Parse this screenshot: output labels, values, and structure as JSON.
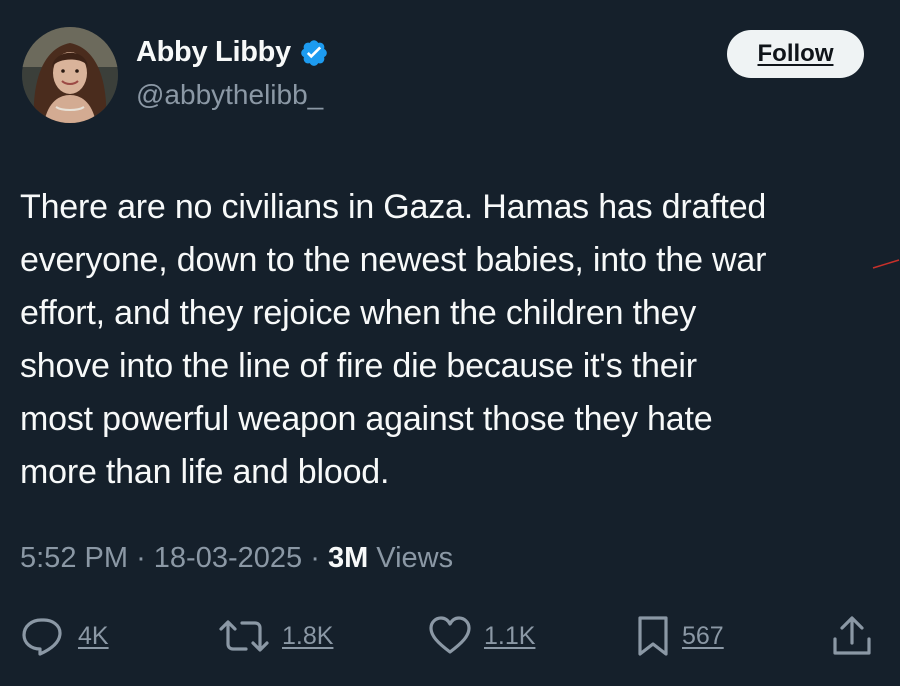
{
  "author": {
    "display_name": "Abby Libby",
    "handle": "@abbythelibb_",
    "verified": true,
    "verified_color": "#1d9bf0"
  },
  "follow_button": {
    "label": "Follow"
  },
  "tweet": {
    "text": "There are no civilians in Gaza. Hamas has drafted\neveryone, down to the newest babies, into the war\neffort, and they rejoice when the children they\nshove into the line of fire die because it's their\nmost powerful weapon against those they hate\nmore than life and blood.",
    "time": "5:52 PM",
    "separator": "·",
    "date": "18-03-2025",
    "views_count": "3M",
    "views_label": "Views"
  },
  "actions": {
    "reply": {
      "icon": "reply-icon",
      "count": "4K"
    },
    "repost": {
      "icon": "repost-icon",
      "count": "1.8K"
    },
    "like": {
      "icon": "heart-icon",
      "count": "1.1K"
    },
    "bookmark": {
      "icon": "bookmark-icon",
      "count": "567"
    },
    "share": {
      "icon": "share-icon"
    }
  },
  "colors": {
    "background": "#15202b",
    "text": "#f7f9f9",
    "secondary_text": "#8b98a5",
    "follow_bg": "#eff3f4"
  }
}
